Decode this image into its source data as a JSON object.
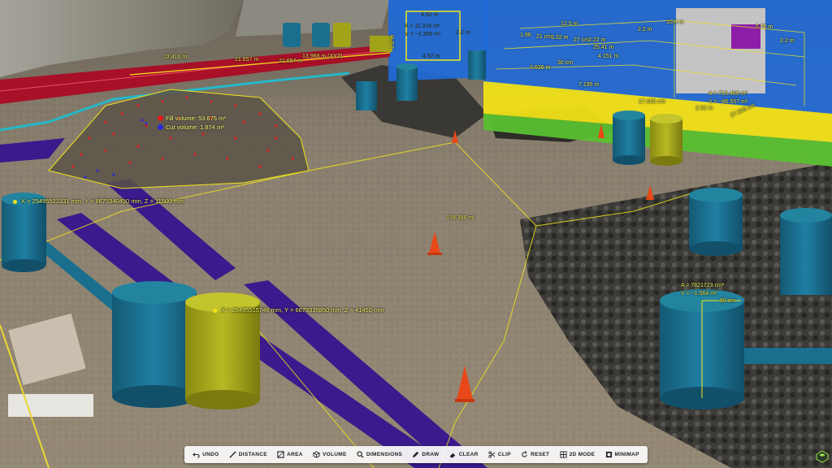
{
  "toolbar": {
    "items": [
      {
        "label": "UNDO",
        "icon": "undo-icon"
      },
      {
        "label": "DISTANCE",
        "icon": "ruler-icon"
      },
      {
        "label": "AREA",
        "icon": "area-icon"
      },
      {
        "label": "VOLUME",
        "icon": "cube-icon"
      },
      {
        "label": "DIMENSIONS",
        "icon": "magnifier-icon"
      },
      {
        "label": "DRAW",
        "icon": "pencil-icon"
      },
      {
        "label": "CLEAR",
        "icon": "eraser-icon"
      },
      {
        "label": "CLIP",
        "icon": "scissors-icon"
      },
      {
        "label": "RESET",
        "icon": "reset-icon"
      },
      {
        "label": "2D MODE",
        "icon": "grid-icon"
      },
      {
        "label": "MINIMAP",
        "icon": "map-icon"
      }
    ]
  },
  "measurements": {
    "pipe_lengths": [
      "22.416 m",
      "21.657 m",
      "21.657 m",
      "13.968 m (XYZ)"
    ],
    "box_width": "4.92 m",
    "box_width_bottom": "4.92 m",
    "box_height": "2.2 m",
    "box_area": "A = 11.316 m²",
    "box_volume": "V = ~1.359 m³",
    "vertical_label": "1.2 m",
    "fill_volume": "Fill volume: 53.675 m³",
    "cut_volume": "Cut volume: 1.874 m³",
    "ground_area": "179.356 m²",
    "coord_1": "X = 25495521331 mm, Y = 6675340450 mm, Z = 11500 mm",
    "coord_2": "X = 25495515746 mm, Y = 6675335850 mm, Z = 41450 mm",
    "cyl_area": "A = 7821723 cm²",
    "cyl_volume": "V = ~1.564 m³",
    "cyl_radius": "50 cm",
    "building": {
      "d1": "12.5 m",
      "d2": "10.4 m",
      "d3": "2.2 m",
      "d4": "5.75 m",
      "d5": "7.195 m",
      "d6": "3.636 m",
      "d7": "30 cm",
      "d8": "4.151 m",
      "d9": "2.52 m",
      "d10": "27.008 cm",
      "d11": "27.008 cm",
      "d12": "1.96",
      "d13": "21 cm",
      "d14": "3.32 m",
      "d15": "27 cm",
      "d16": "2.22 m",
      "d17": "25.41 m",
      "d18": "2.2 m",
      "area": "A = 719.469 m²",
      "volume": "V = ~86.557 m³"
    }
  },
  "colors": {
    "pipe_purple": "#3a1a8c",
    "pipe_red": "#a81028",
    "cyl_teal": "#1a6f8e",
    "cyl_olive": "#a3a31a",
    "building_blue": "#1f6ad8",
    "measure_yellow": "#f2e41a",
    "fill_red": "#e81818",
    "cut_blue": "#2828d8"
  }
}
